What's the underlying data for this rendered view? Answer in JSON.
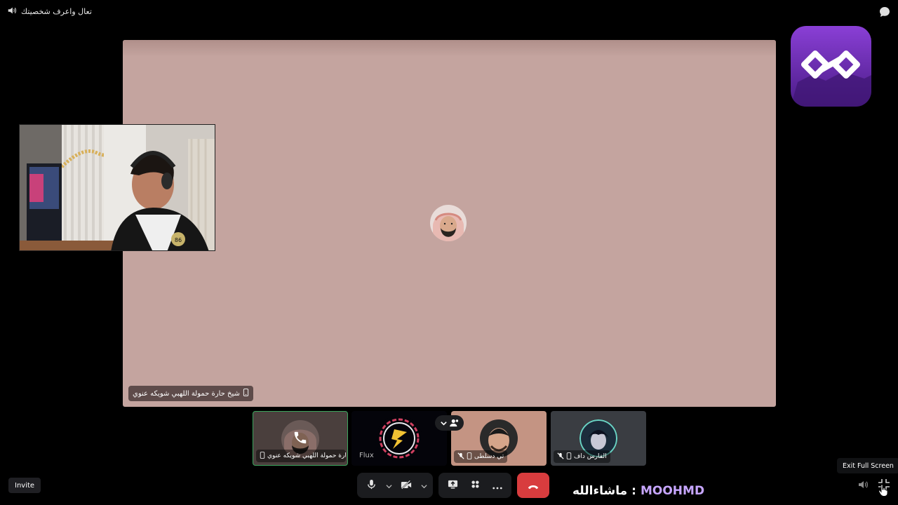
{
  "window": {
    "title": "تعال واعرف شخصيتك",
    "icons": {
      "top_left": "speaker-icon",
      "top_right": "chat-bubble-icon"
    }
  },
  "stage": {
    "background": "#c4a49f",
    "speaker_label": "شيخ حارة حمولة اللهبي شويكه عنوي",
    "label_icon": "phone-icon"
  },
  "participants": [
    {
      "label": "حارة حمولة اللهبي شويكه عنوي...",
      "status_icons": [
        "phone-icon"
      ],
      "speaking": true,
      "overlay_icon": "phone-call-icon"
    },
    {
      "label": "Flux",
      "status_icons": []
    },
    {
      "label": "تي دسلطى",
      "status_icons": [
        "mic-muted-icon",
        "phone-icon"
      ]
    },
    {
      "label": "الفارس داف",
      "status_icons": [
        "mic-muted-icon",
        "phone-icon"
      ]
    }
  ],
  "overflow": {
    "icons": [
      "chevron-down-icon",
      "people-icon"
    ]
  },
  "invite": {
    "label": "Invite"
  },
  "controls": {
    "mic_icon": "microphone-icon",
    "camera_icon": "camera-off-icon",
    "screen_share_icon": "screen-share-icon",
    "activities_icon": "activities-icon",
    "more_icon": "more-icon",
    "end_call_icon": "hang-up-icon",
    "end_call_color": "#d83c3e"
  },
  "caption": {
    "name": "MOOHMD",
    "separator": ":",
    "text": "ماشاءالله"
  },
  "tooltip": {
    "label": "Exit Full Screen"
  },
  "accent": {
    "speaking": "#3ba55d",
    "caption_name": "#c7a6ff"
  }
}
